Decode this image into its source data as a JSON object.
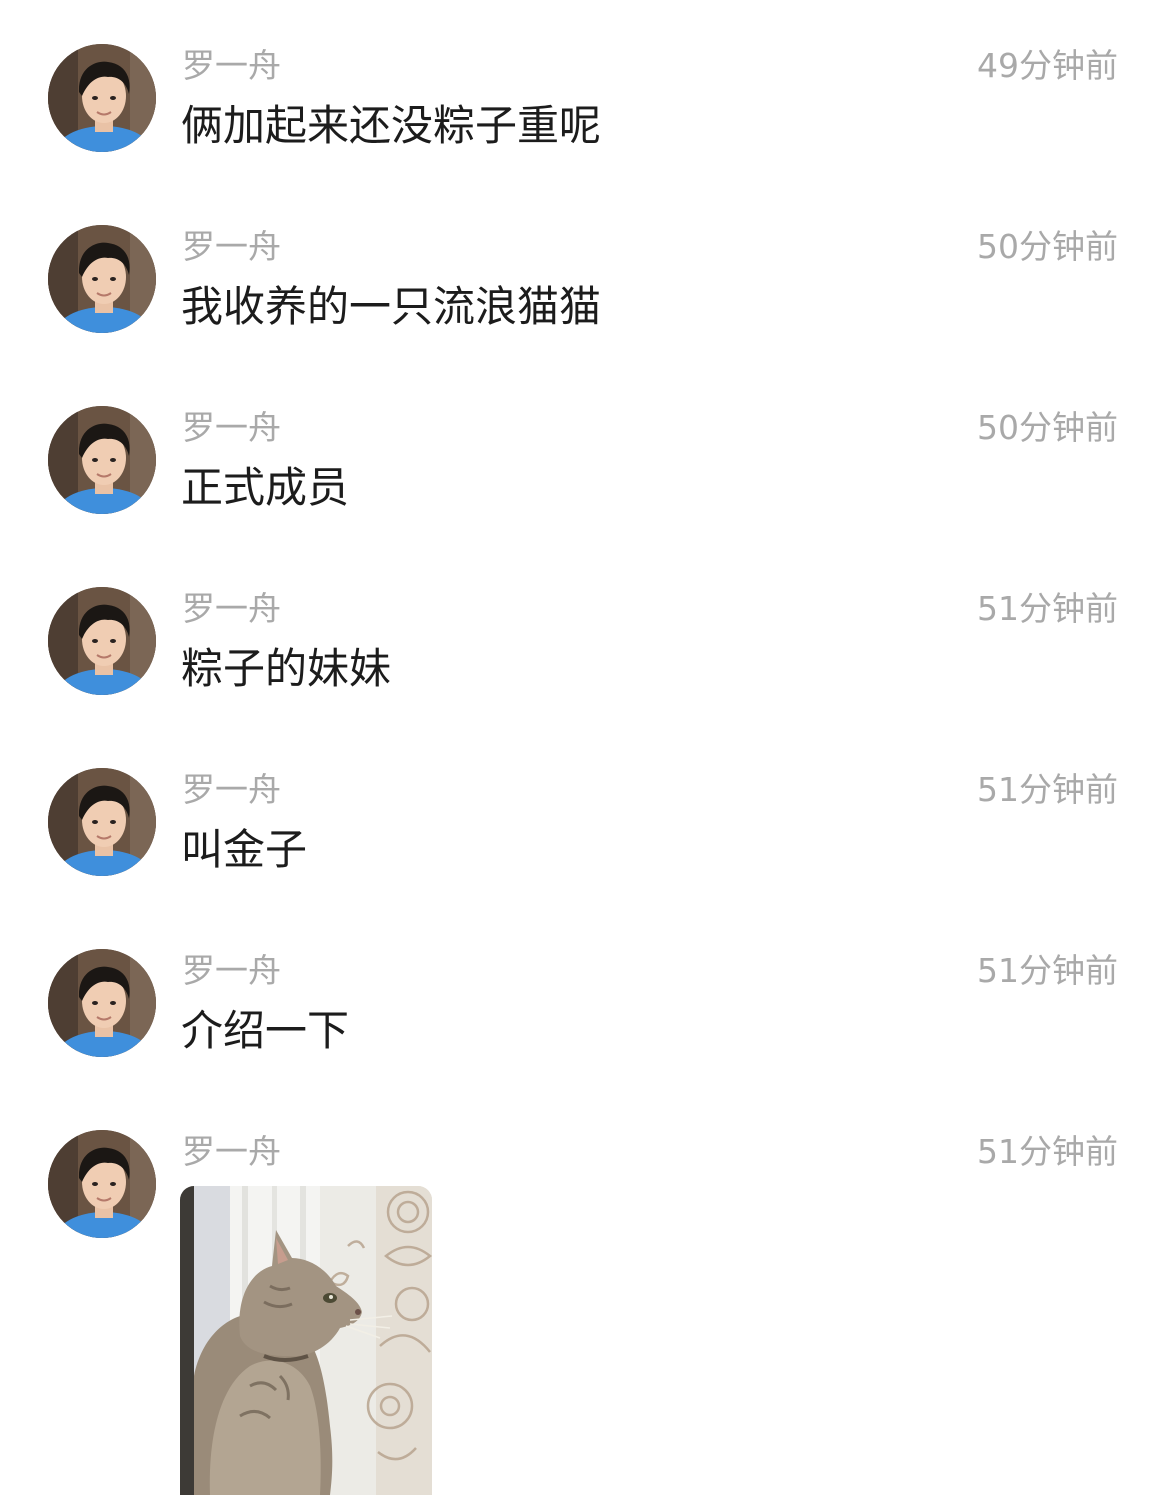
{
  "messages": [
    {
      "sender": "罗一舟",
      "time": "49分钟前",
      "text": "俩加起来还没粽子重呢"
    },
    {
      "sender": "罗一舟",
      "time": "50分钟前",
      "text": "我收养的一只流浪猫猫"
    },
    {
      "sender": "罗一舟",
      "time": "50分钟前",
      "text": "正式成员"
    },
    {
      "sender": "罗一舟",
      "time": "51分钟前",
      "text": "粽子的妹妹"
    },
    {
      "sender": "罗一舟",
      "time": "51分钟前",
      "text": "叫金子"
    },
    {
      "sender": "罗一舟",
      "time": "51分钟前",
      "text": "介绍一下"
    },
    {
      "sender": "罗一舟",
      "time": "51分钟前",
      "image": "cat-photo"
    }
  ],
  "colors": {
    "meta_text": "#a9a9a9",
    "body_text": "#1c1c1c",
    "avatar_shirt": "#3f8fdc"
  }
}
